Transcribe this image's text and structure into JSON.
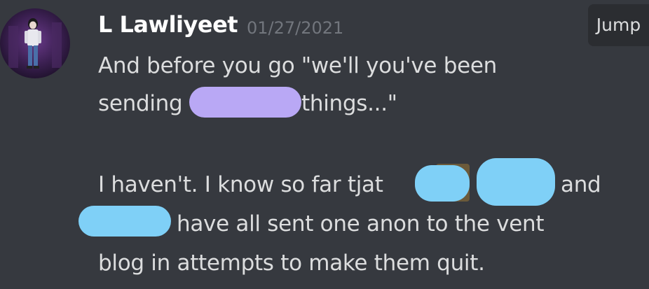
{
  "message": {
    "author": "L Lawliyeet",
    "timestamp": "01/27/2021",
    "jump_label": "Jump",
    "lines": [
      "And before you go \"we'll you've been",
      "sending",
      "things...\"",
      "I haven't. I know so far tjat",
      "and",
      "have all sent one anon to the vent",
      "blog in attempts to make them quit."
    ]
  },
  "colors": {
    "background": "#36393f",
    "username": "#ffffff",
    "timestamp": "#72767d",
    "text": "#dcddde",
    "redact_purple": "#b9a8f5",
    "redact_blue": "#7fd0f7"
  },
  "icons": {
    "avatar": "user-avatar-icon"
  }
}
